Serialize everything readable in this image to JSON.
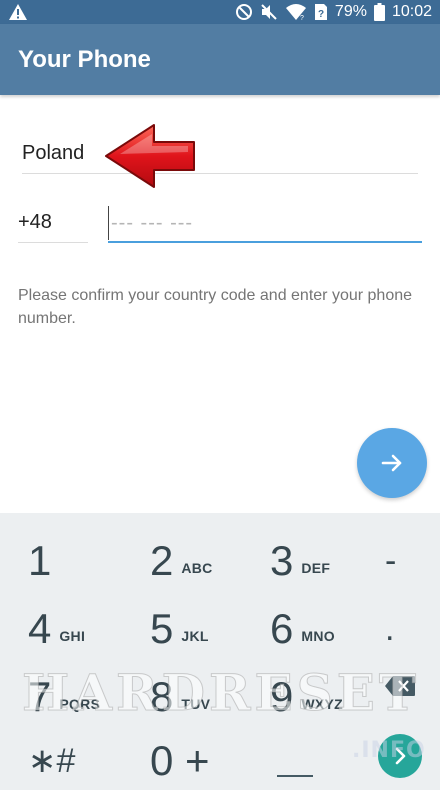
{
  "status_bar": {
    "battery_percent": "79%",
    "time": "10:02",
    "icons": [
      "warning-icon",
      "do-not-disturb-icon",
      "mute-icon",
      "wifi-icon",
      "sim-unknown-icon",
      "battery-icon"
    ]
  },
  "header": {
    "title": "Your Phone"
  },
  "form": {
    "country": "Poland",
    "country_code": "+48",
    "phone_value": "",
    "phone_placeholder": "--- --- ---",
    "hint": "Please confirm your country code and enter your phone number."
  },
  "colors": {
    "status_bar": "#3d6b95",
    "action_bar": "#527da3",
    "accent": "#4a9fdd",
    "fab": "#5aa7e4",
    "keyboard_bg": "#eceff1",
    "enter_key": "#26a69a",
    "arrow": "#e0141b"
  },
  "keyboard": {
    "rows": [
      [
        {
          "num": "1",
          "letters": ""
        },
        {
          "num": "2",
          "letters": "ABC"
        },
        {
          "num": "3",
          "letters": "DEF"
        },
        {
          "num": "-",
          "letters": ""
        }
      ],
      [
        {
          "num": "4",
          "letters": "GHI"
        },
        {
          "num": "5",
          "letters": "JKL"
        },
        {
          "num": "6",
          "letters": "MNO"
        },
        {
          "num": ".",
          "letters": ""
        }
      ],
      [
        {
          "num": "7",
          "letters": "PQRS"
        },
        {
          "num": "8",
          "letters": "TUV"
        },
        {
          "num": "9",
          "letters": "WXYZ"
        },
        {
          "num": "",
          "letters": ""
        }
      ],
      [
        {
          "num": "∗#",
          "letters": ""
        },
        {
          "num": "0 +",
          "letters": ""
        },
        {
          "num": "",
          "letters": ""
        },
        {
          "num": "",
          "letters": ""
        }
      ]
    ]
  },
  "watermark": {
    "text": "HARDRESET",
    "sub": ".INFO"
  }
}
